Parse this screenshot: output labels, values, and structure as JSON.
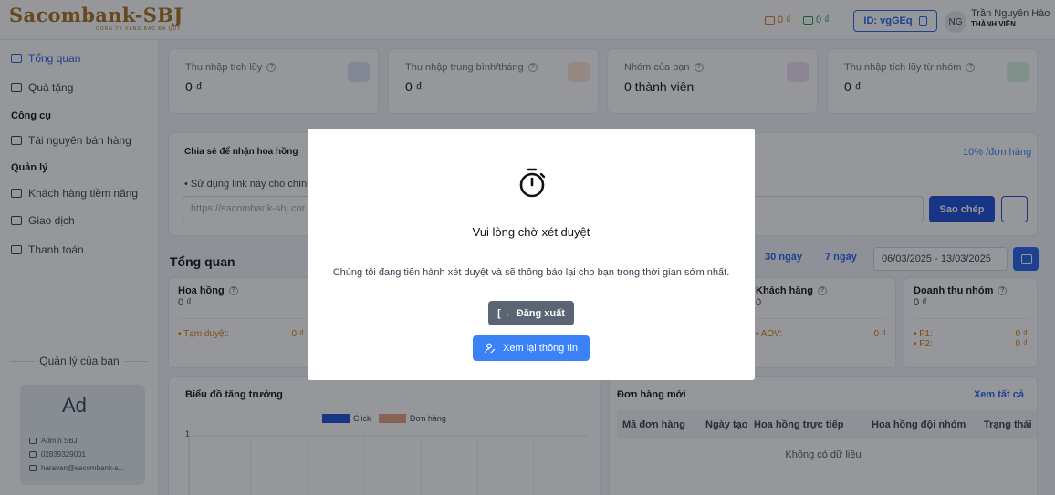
{
  "brand": {
    "name": "Sacombank-SBJ",
    "tagline": "CÔNG TY VÀNG BẠC ĐÁ QUÝ"
  },
  "header": {
    "wallet_1": "0 ₫",
    "wallet_2": "0 ₫",
    "user_id": "ID: vgGEq",
    "avatar_initials": "NG",
    "user_name": "Trần Nguyên Hào",
    "user_role": "THÀNH VIÊN"
  },
  "sidebar": {
    "overview": "Tổng quan",
    "gifts": "Quà tặng",
    "tools_heading": "Công cụ",
    "sales_resources": "Tài nguyên bán hàng",
    "manage_heading": "Quản lý",
    "leads": "Khách hàng tiềm năng",
    "transactions": "Giao dịch",
    "payments": "Thanh toán",
    "manager_title": "Quản lý của bạn",
    "manager": {
      "initials": "Ad",
      "name": "Admin SBJ",
      "phone": "02839329001",
      "email": "haravan@sacombank-s..."
    }
  },
  "stats": [
    {
      "label": "Thu nhập tích lũy",
      "value": "0 ₫"
    },
    {
      "label": "Thu nhập trung bình/tháng",
      "value": "0 ₫"
    },
    {
      "label": "Nhóm của bạn",
      "value": "0 thành viên"
    },
    {
      "label": "Thu nhập tích lũy từ nhóm",
      "value": "0 ₫"
    }
  ],
  "share": {
    "title": "Chia sẻ để nhận hoa hồng",
    "rate": "10% /đơn hàng",
    "note": "• Sử dụng link này cho chính",
    "link": "https://sacombank-sbj.cor",
    "copy_label": "Sao chép"
  },
  "overview": {
    "title": "Tổng quan",
    "range_30": "30 ngày",
    "range_7": "7 ngày",
    "date_range": "06/03/2025 - 13/03/2025",
    "commission": {
      "label": "Hoa hồng",
      "value": "0 ₫",
      "sub_label": "• Tạm duyệt:",
      "sub_value": "0 ₫"
    },
    "customers": {
      "label": "Khách hàng",
      "value": "0",
      "sub_label": "• AOV:",
      "sub_value": "0 ₫"
    },
    "group_revenue": {
      "label": "Doanh thu nhóm",
      "value": "0 ₫",
      "f1_label": "• F1:",
      "f1_value": "0 ₫",
      "f2_label": "• F2:",
      "f2_value": "0 ₫"
    }
  },
  "growth_chart": {
    "title": "Biểu đồ tăng trưởng",
    "legend_click": "Click",
    "legend_orders": "Đơn hàng",
    "y_tick": "1",
    "click_color": "#1d4ed8",
    "orders_color": "#e9a07a"
  },
  "orders": {
    "title": "Đơn hàng mới",
    "see_all": "Xem tất cả",
    "columns": [
      "Mã đơn hàng",
      "Ngày tạo",
      "Hoa hồng trực tiếp",
      "Hoa hồng đội nhóm",
      "Trạng thái"
    ],
    "empty": "Không có dữ liệu"
  },
  "modal": {
    "icon": "stopwatch-icon",
    "title": "Vui lòng chờ xét duyệt",
    "message": "Chúng tôi đang tiến hành xét duyệt và sẽ thông báo lại cho bạn trong thời gian sớm nhất.",
    "logout_icon": "[→",
    "logout_label": "Đăng xuất",
    "review_label": "Xem lại thông tin"
  },
  "colors": {
    "primary": "#2563eb",
    "gold": "#a8721a",
    "overlay": "rgba(20,24,33,0.45)"
  }
}
